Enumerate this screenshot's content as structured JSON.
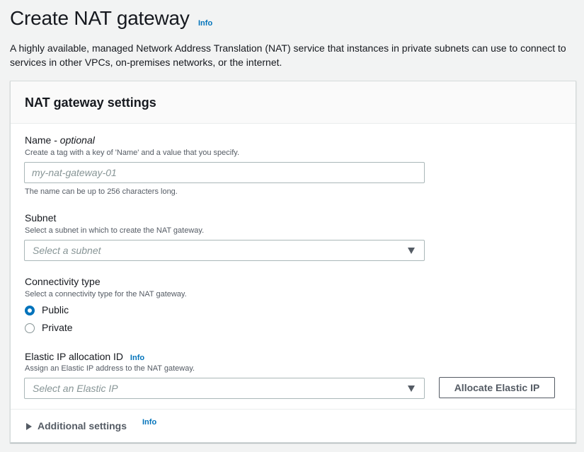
{
  "header": {
    "title": "Create NAT gateway",
    "info": "Info",
    "description": "A highly available, managed Network Address Translation (NAT) service that instances in private subnets can use to connect to services in other VPCs, on-premises networks, or the internet."
  },
  "panel": {
    "title": "NAT gateway settings",
    "name_field": {
      "label": "Name - ",
      "label_optional": "optional",
      "description": "Create a tag with a key of 'Name' and a value that you specify.",
      "value": "",
      "placeholder": "my-nat-gateway-01",
      "constraint": "The name can be up to 256 characters long."
    },
    "subnet_field": {
      "label": "Subnet",
      "description": "Select a subnet in which to create the NAT gateway.",
      "placeholder": "Select a subnet"
    },
    "connectivity": {
      "label": "Connectivity type",
      "description": "Select a connectivity type for the NAT gateway.",
      "options": [
        {
          "label": "Public",
          "selected": true
        },
        {
          "label": "Private",
          "selected": false
        }
      ]
    },
    "elastic_ip": {
      "label": "Elastic IP allocation ID",
      "info": "Info",
      "description": "Assign an Elastic IP address to the NAT gateway.",
      "placeholder": "Select an Elastic IP",
      "allocate_button": "Allocate Elastic IP"
    },
    "additional_settings": {
      "label": "Additional settings",
      "info": "Info"
    }
  },
  "colors": {
    "accent": "#0073bb",
    "text": "#16191f",
    "secondary_text": "#545b64",
    "placeholder": "#879596",
    "border": "#aab7b8",
    "background": "#f2f3f3"
  },
  "icons": [
    "caret-down-icon",
    "radio-checked-icon",
    "radio-unchecked-icon",
    "caret-right-icon"
  ]
}
